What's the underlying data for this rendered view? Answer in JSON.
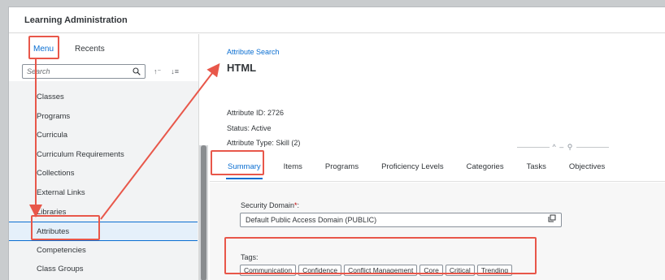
{
  "app": {
    "title": "Learning Administration"
  },
  "sidebar": {
    "tabs": [
      {
        "label": "Menu"
      },
      {
        "label": "Recents"
      }
    ],
    "search": {
      "placeholder": "Search"
    },
    "items": [
      {
        "label": "Classes"
      },
      {
        "label": "Programs"
      },
      {
        "label": "Curricula"
      },
      {
        "label": "Curriculum Requirements"
      },
      {
        "label": "Collections"
      },
      {
        "label": "External Links"
      },
      {
        "label": "Libraries"
      },
      {
        "label": "Attributes"
      },
      {
        "label": "Competencies"
      },
      {
        "label": "Class Groups"
      }
    ],
    "selected": "Attributes"
  },
  "content": {
    "breadcrumb": "Attribute Search",
    "title": "HTML",
    "info": {
      "id": "Attribute ID: 2726",
      "status": "Status: Active",
      "type": "Attribute Type: Skill (2)"
    },
    "tabs": [
      {
        "label": "Summary"
      },
      {
        "label": "Items"
      },
      {
        "label": "Programs"
      },
      {
        "label": "Proficiency Levels"
      },
      {
        "label": "Categories"
      },
      {
        "label": "Tasks"
      },
      {
        "label": "Objectives"
      }
    ],
    "active_tab": "Summary",
    "security_domain": {
      "label": "Security Domain",
      "required_mark": "*",
      "colon": ":",
      "value": "Default Public Access Domain (PUBLIC)"
    },
    "tags": {
      "label": "Tags:",
      "items": [
        "Communication",
        "Confidence",
        "Conflict Management",
        "Core",
        "Critical",
        "Trending"
      ]
    }
  },
  "colors": {
    "accent": "#0a6ed1",
    "highlight": "#e8574a",
    "required": "#bb0000"
  }
}
